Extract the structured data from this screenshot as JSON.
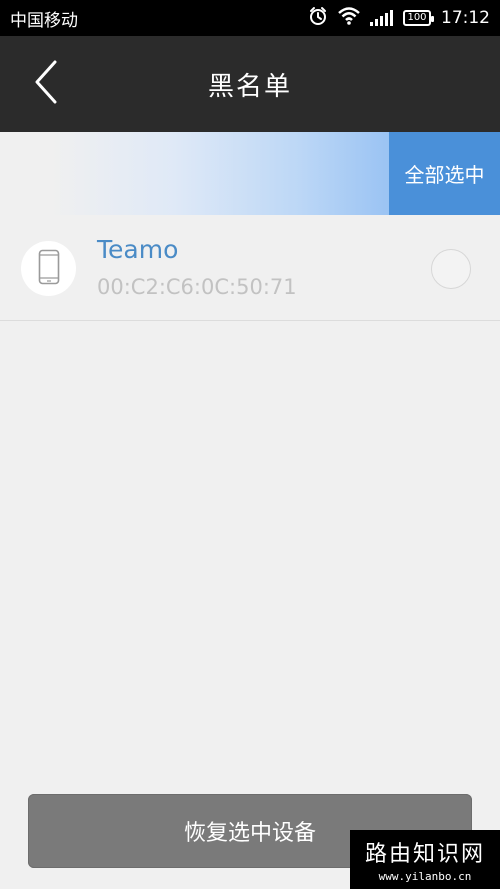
{
  "status_bar": {
    "carrier": "中国移动",
    "battery": "100",
    "time": "17:12",
    "icons": [
      "alarm-icon",
      "wifi-icon",
      "signal-icon",
      "battery-icon"
    ]
  },
  "header": {
    "title": "黑名单",
    "back_icon": "chevron-left-icon"
  },
  "select_all": {
    "label": "全部选中",
    "accent_color": "#4a90d9"
  },
  "devices": [
    {
      "name": "Teamo",
      "mac": "00:C2:C6:0C:50:71",
      "icon": "phone-icon",
      "selected": false
    }
  ],
  "footer": {
    "restore_label": "恢复选中设备"
  },
  "watermark": {
    "text": "路由知识网",
    "url": "www.yilanbo.cn"
  }
}
